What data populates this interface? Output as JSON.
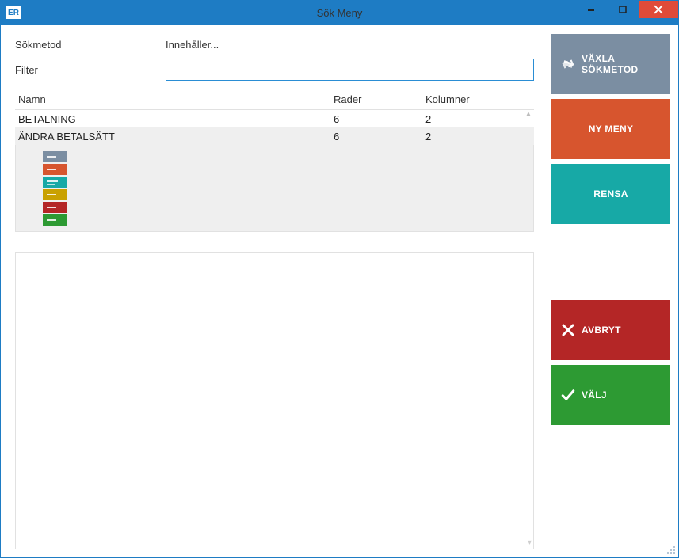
{
  "window": {
    "app_icon_text": "ER",
    "title": "Sök Meny"
  },
  "form": {
    "sokmetod_label": "Sökmetod",
    "sokmetod_value": "Innehåller...",
    "filter_label": "Filter",
    "filter_value": ""
  },
  "table": {
    "headers": {
      "name": "Namn",
      "rows": "Rader",
      "cols": "Kolumner"
    },
    "rows": [
      {
        "name": "BETALNING",
        "rows": "6",
        "cols": "2"
      },
      {
        "name": "ÄNDRA BETALSÄTT",
        "rows": "6",
        "cols": "2"
      }
    ]
  },
  "preview": {
    "tiles": [
      {
        "color": "#7b8ea2",
        "style": "single"
      },
      {
        "color": "#d7552e",
        "style": "single"
      },
      {
        "color": "#17a9a6",
        "style": "double"
      },
      {
        "color": "#c9a100",
        "style": "single"
      },
      {
        "color": "#b42626",
        "style": "single"
      },
      {
        "color": "#2d9a33",
        "style": "single"
      }
    ]
  },
  "buttons": {
    "switch": "VÄXLA SÖKMETOD",
    "new": "NY MENY",
    "clear": "RENSA",
    "cancel": "AVBRYT",
    "select": "VÄLJ"
  }
}
